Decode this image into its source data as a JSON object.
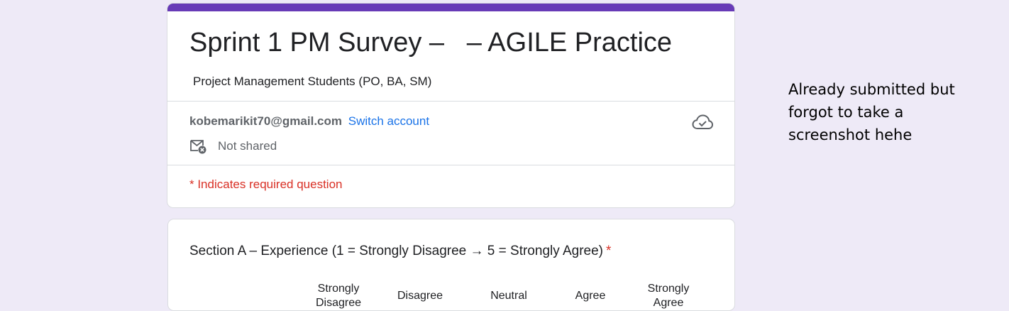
{
  "colors": {
    "page_background": "#eeeaf7",
    "accent": "#673ab7",
    "link": "#1a73e8",
    "required": "#d93025",
    "text_primary": "#202124",
    "text_secondary": "#5f6368"
  },
  "form": {
    "title": "Sprint 1 PM Survey –   – AGILE Practice",
    "subtitle": "Project Management Students (PO, BA, SM)",
    "account": {
      "email": "kobemarikit70@gmail.com",
      "switch_label": "Switch account",
      "shared_icon": "mail-not-shared-icon",
      "shared_status": "Not shared",
      "save_icon": "cloud-saved-icon"
    },
    "required_note": "* Indicates required question"
  },
  "question": {
    "title": "Section A – Experience (1 = Strongly Disagree → 5 = Strongly Agree)",
    "required_mark": "*",
    "scale_labels": [
      "Strongly\nDisagree",
      "Disagree",
      "Neutral",
      "Agree",
      "Strongly\nAgree"
    ]
  },
  "side_note": "Already submitted but forgot to take a screenshot hehe"
}
